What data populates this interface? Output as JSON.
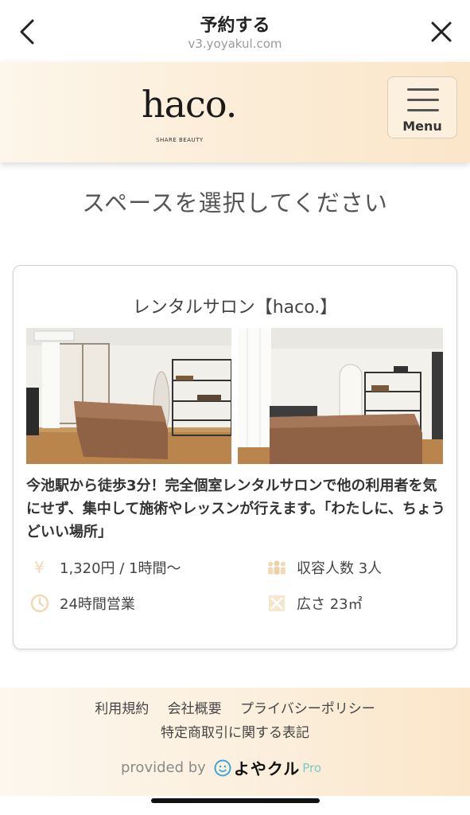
{
  "browser": {
    "title": "予約する",
    "url": "v3.yoyakul.com",
    "back_icon": "chevron-left-icon",
    "close_icon": "close-icon"
  },
  "header": {
    "logo_text": "haco.",
    "logo_sub": "SHARE BEAUTY",
    "menu_label": "Menu"
  },
  "main": {
    "heading": "スペースを選択してください",
    "card": {
      "title": "レンタルサロン【haco.】",
      "description": "今池駅から徒歩3分！完全個室レンタルサロンで他の利用者を気にせず、集中して施術やレッスンが行えます。「わたしに、ちょうどいい場所」",
      "price": "1,320円 / 1時間〜",
      "capacity": "収容人数 3人",
      "hours": "24時間営業",
      "area": "広さ 23㎡"
    }
  },
  "footer": {
    "links": [
      "利用規約",
      "会社概要",
      "プライバシーポリシー"
    ],
    "link_tokushoho": "特定商取引に関する表記",
    "provided_by": "provided by",
    "brand": "よやクル",
    "brand_suffix": "Pro"
  },
  "colors": {
    "accent_gold": "#e9c48c",
    "header_bg": "#fbecd6",
    "footer_bg": "#fbeedb"
  }
}
